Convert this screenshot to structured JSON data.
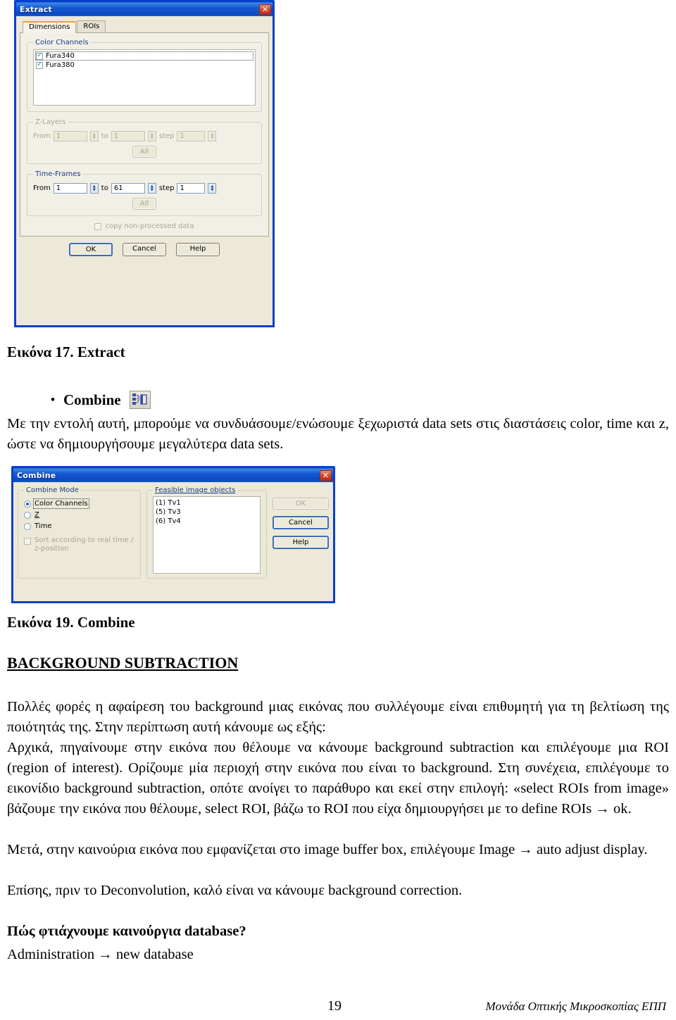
{
  "extract_dialog": {
    "title": "Extract",
    "close_label": "✕",
    "tabs": [
      {
        "label": "Dimensions",
        "active": true
      },
      {
        "label": "ROIs",
        "active": false
      }
    ],
    "color_channels": {
      "legend": "Color Channels",
      "items": [
        {
          "label": "Fura340",
          "checked": true
        },
        {
          "label": "Fura380",
          "checked": true
        }
      ]
    },
    "z_layers": {
      "legend": "Z-Layers",
      "from_label": "From",
      "from_value": "1",
      "to_label": "to",
      "to_value": "1",
      "step_label": "step",
      "step_value": "1",
      "all_label": "All"
    },
    "time_frames": {
      "legend": "Time-Frames",
      "from_label": "From",
      "from_value": "1",
      "to_label": "to",
      "to_value": "61",
      "step_label": "step",
      "step_value": "1",
      "all_label": "All"
    },
    "copy_checkbox_label": "copy non-processed data",
    "buttons": {
      "ok": "OK",
      "cancel": "Cancel",
      "help": "Help"
    }
  },
  "combine_dialog": {
    "title": "Combine",
    "close_label": "✕",
    "mode": {
      "legend": "Combine Mode",
      "options": [
        {
          "label": "Color Channels",
          "selected": true
        },
        {
          "label": "Z",
          "selected": false
        },
        {
          "label": "Time",
          "selected": false
        }
      ],
      "sort_checkbox_label": "Sort according to real time / z-position"
    },
    "objects": {
      "legend": "Feasible image objects",
      "items": [
        "(1) Tv1",
        "(5) Tv3",
        "(6) Tv4"
      ]
    },
    "buttons": {
      "ok": "OK",
      "cancel": "Cancel",
      "help": "Help"
    }
  },
  "document": {
    "figure17_caption": "Εικόνα 17. Extract",
    "combine_bullet": {
      "dot": "•",
      "label": "Combine"
    },
    "combine_paragraph": "Με την εντολή αυτή, μπορούμε να συνδυάσουμε/ενώσουμε ξεχωριστά data sets στις διαστάσεις color, time και z, ώστε να δημιουργήσουμε μεγαλύτερα data sets.",
    "figure19_caption": "Εικόνα 19. Combine",
    "section_title": "BACKGROUND SUBTRACTION",
    "body_paragraphs": [
      "Πολλές φορές η αφαίρεση του background μιας εικόνας που συλλέγουμε είναι επιθυμητή για τη βελτίωση της ποιότητάς της. Στην περίπτωση αυτή κάνουμε ως εξής:",
      "Αρχικά, πηγαίνουμε στην εικόνα που θέλουμε να κάνουμε background subtraction και επιλέγουμε μια ROI (region of interest). Ορίζουμε μία περιοχή στην εικόνα που είναι το background. Στη συνέχεια, επιλέγουμε το εικονίδιο background subtraction, οπότε ανοίγει το παράθυρο και εκεί στην επιλογή: «select ROIs from image» βάζουμε την εικόνα που θέλουμε, select ROI, βάζω το ROI που είχα δημιουργήσει με το define ROIs → ok.",
      "Μετά, στην καινούρια εικόνα που εμφανίζεται στο image buffer box, επιλέγουμε Image → auto adjust display.",
      "Επίσης, πριν το Deconvolution, καλό είναι να κάνουμε  background correction."
    ],
    "question_title": "Πώς φτιάχνουμε καινούργια database?",
    "question_answer": "Administration → new database",
    "footer": {
      "page_number": "19",
      "organization": "Μονάδα Οπτικής Μικροσκοπίας ΕΠΠ"
    }
  }
}
